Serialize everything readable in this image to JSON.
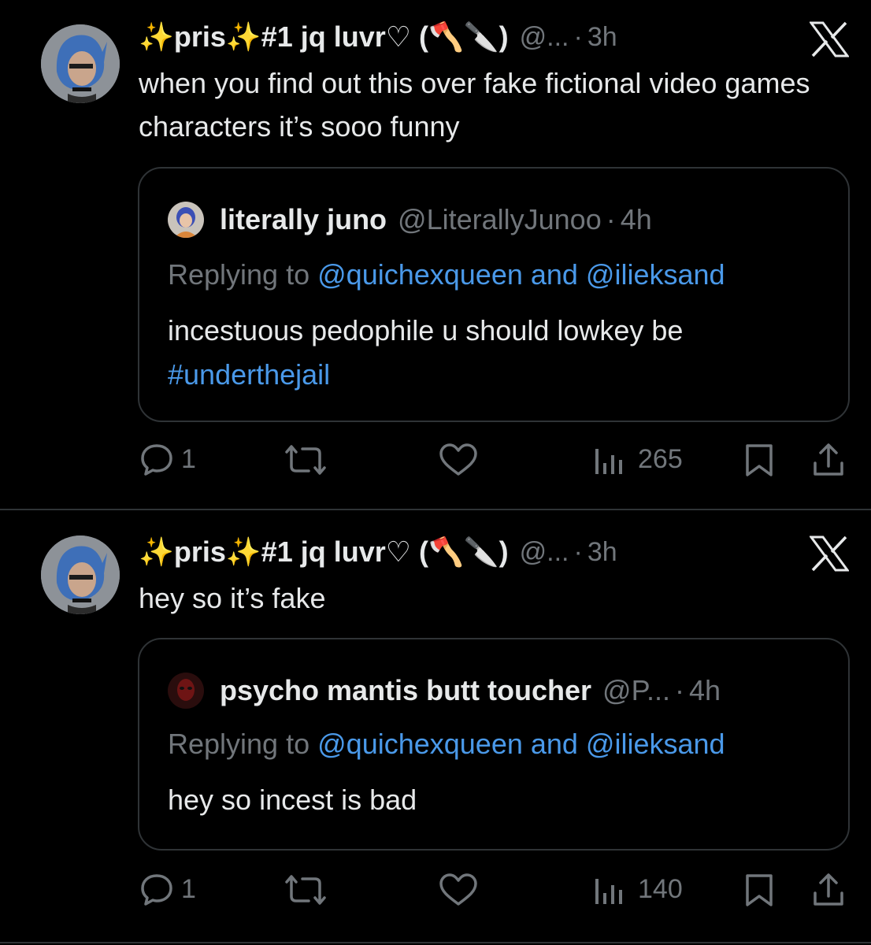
{
  "posts": [
    {
      "author_name": "✨pris✨#1 jq luvr♡ (🪓🔪)",
      "handle": "@...",
      "separator": "·",
      "time": "3h",
      "text": "when you find out this over fake fictional video games characters it’s sooo funny",
      "quote": {
        "author_name": "literally juno",
        "handle": "@LiterallyJunoo",
        "separator": "·",
        "time": "4h",
        "replying_prefix": "Replying to",
        "replying_targets": "@quichexqueen and @ilieksand",
        "text": "incestuous pedophile u should lowkey be",
        "hashtag": "#underthejail"
      },
      "stats": {
        "replies": "1",
        "views": "265"
      }
    },
    {
      "author_name": "✨pris✨#1 jq luvr♡ (🪓🔪)",
      "handle": "@...",
      "separator": "·",
      "time": "3h",
      "text": "hey so it’s fake",
      "quote": {
        "author_name": "psycho mantis butt toucher",
        "handle": "@P...",
        "separator": "·",
        "time": "4h",
        "replying_prefix": "Replying to",
        "replying_targets": "@quichexqueen and @ilieksand",
        "text": "hey so incest is bad"
      },
      "stats": {
        "replies": "1",
        "views": "140"
      }
    }
  ],
  "icons": {
    "reply": "speech-bubble-icon",
    "repost": "repost-arrows-icon",
    "like": "heart-icon",
    "views": "bar-chart-icon",
    "bookmark": "bookmark-icon",
    "share": "share-upload-icon",
    "platform": "x-logo-icon"
  },
  "colors": {
    "background": "#000000",
    "text": "#e7e9ea",
    "muted": "#71767b",
    "link": "#4a99e9",
    "border": "#2f3336"
  }
}
